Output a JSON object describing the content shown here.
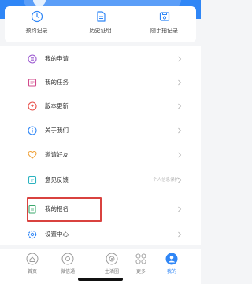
{
  "quick_actions": [
    {
      "label": "预约记录",
      "icon": "clock-icon"
    },
    {
      "label": "历史证明",
      "icon": "document-icon"
    },
    {
      "label": "随手拍记录",
      "icon": "camera-icon"
    }
  ],
  "menu": [
    {
      "label": "我的申请",
      "icon": "list-icon",
      "color": "#9b59d0",
      "hint": ""
    },
    {
      "label": "我的任务",
      "icon": "task-icon",
      "color": "#d14a8b",
      "hint": ""
    },
    {
      "label": "版本更新",
      "icon": "update-icon",
      "color": "#e8504a",
      "hint": ""
    },
    {
      "label": "关于我们",
      "icon": "info-icon",
      "color": "#2f86f6",
      "hint": ""
    },
    {
      "label": "邀请好友",
      "icon": "heart-icon",
      "color": "#f0a23a",
      "hint": ""
    },
    {
      "label": "意见反馈",
      "icon": "feedback-icon",
      "color": "#2bb3c0",
      "hint": "个人信息保护"
    },
    {
      "label": "我的报名",
      "icon": "signup-icon",
      "color": "#3aa86b",
      "hint": ""
    },
    {
      "label": "设置中心",
      "icon": "settings-icon",
      "color": "#2f86f6",
      "hint": ""
    }
  ],
  "tabs": [
    {
      "label": "首页",
      "icon": "home-icon",
      "active": false
    },
    {
      "label": "微信通",
      "icon": "chat-icon",
      "active": false
    },
    {
      "label": "生活圈",
      "icon": "life-icon",
      "active": false
    },
    {
      "label": "更多",
      "icon": "grid-icon",
      "active": false
    },
    {
      "label": "我的",
      "icon": "profile-icon",
      "active": true
    }
  ],
  "colors": {
    "accent": "#2f86f6",
    "highlight": "#d9423f"
  }
}
